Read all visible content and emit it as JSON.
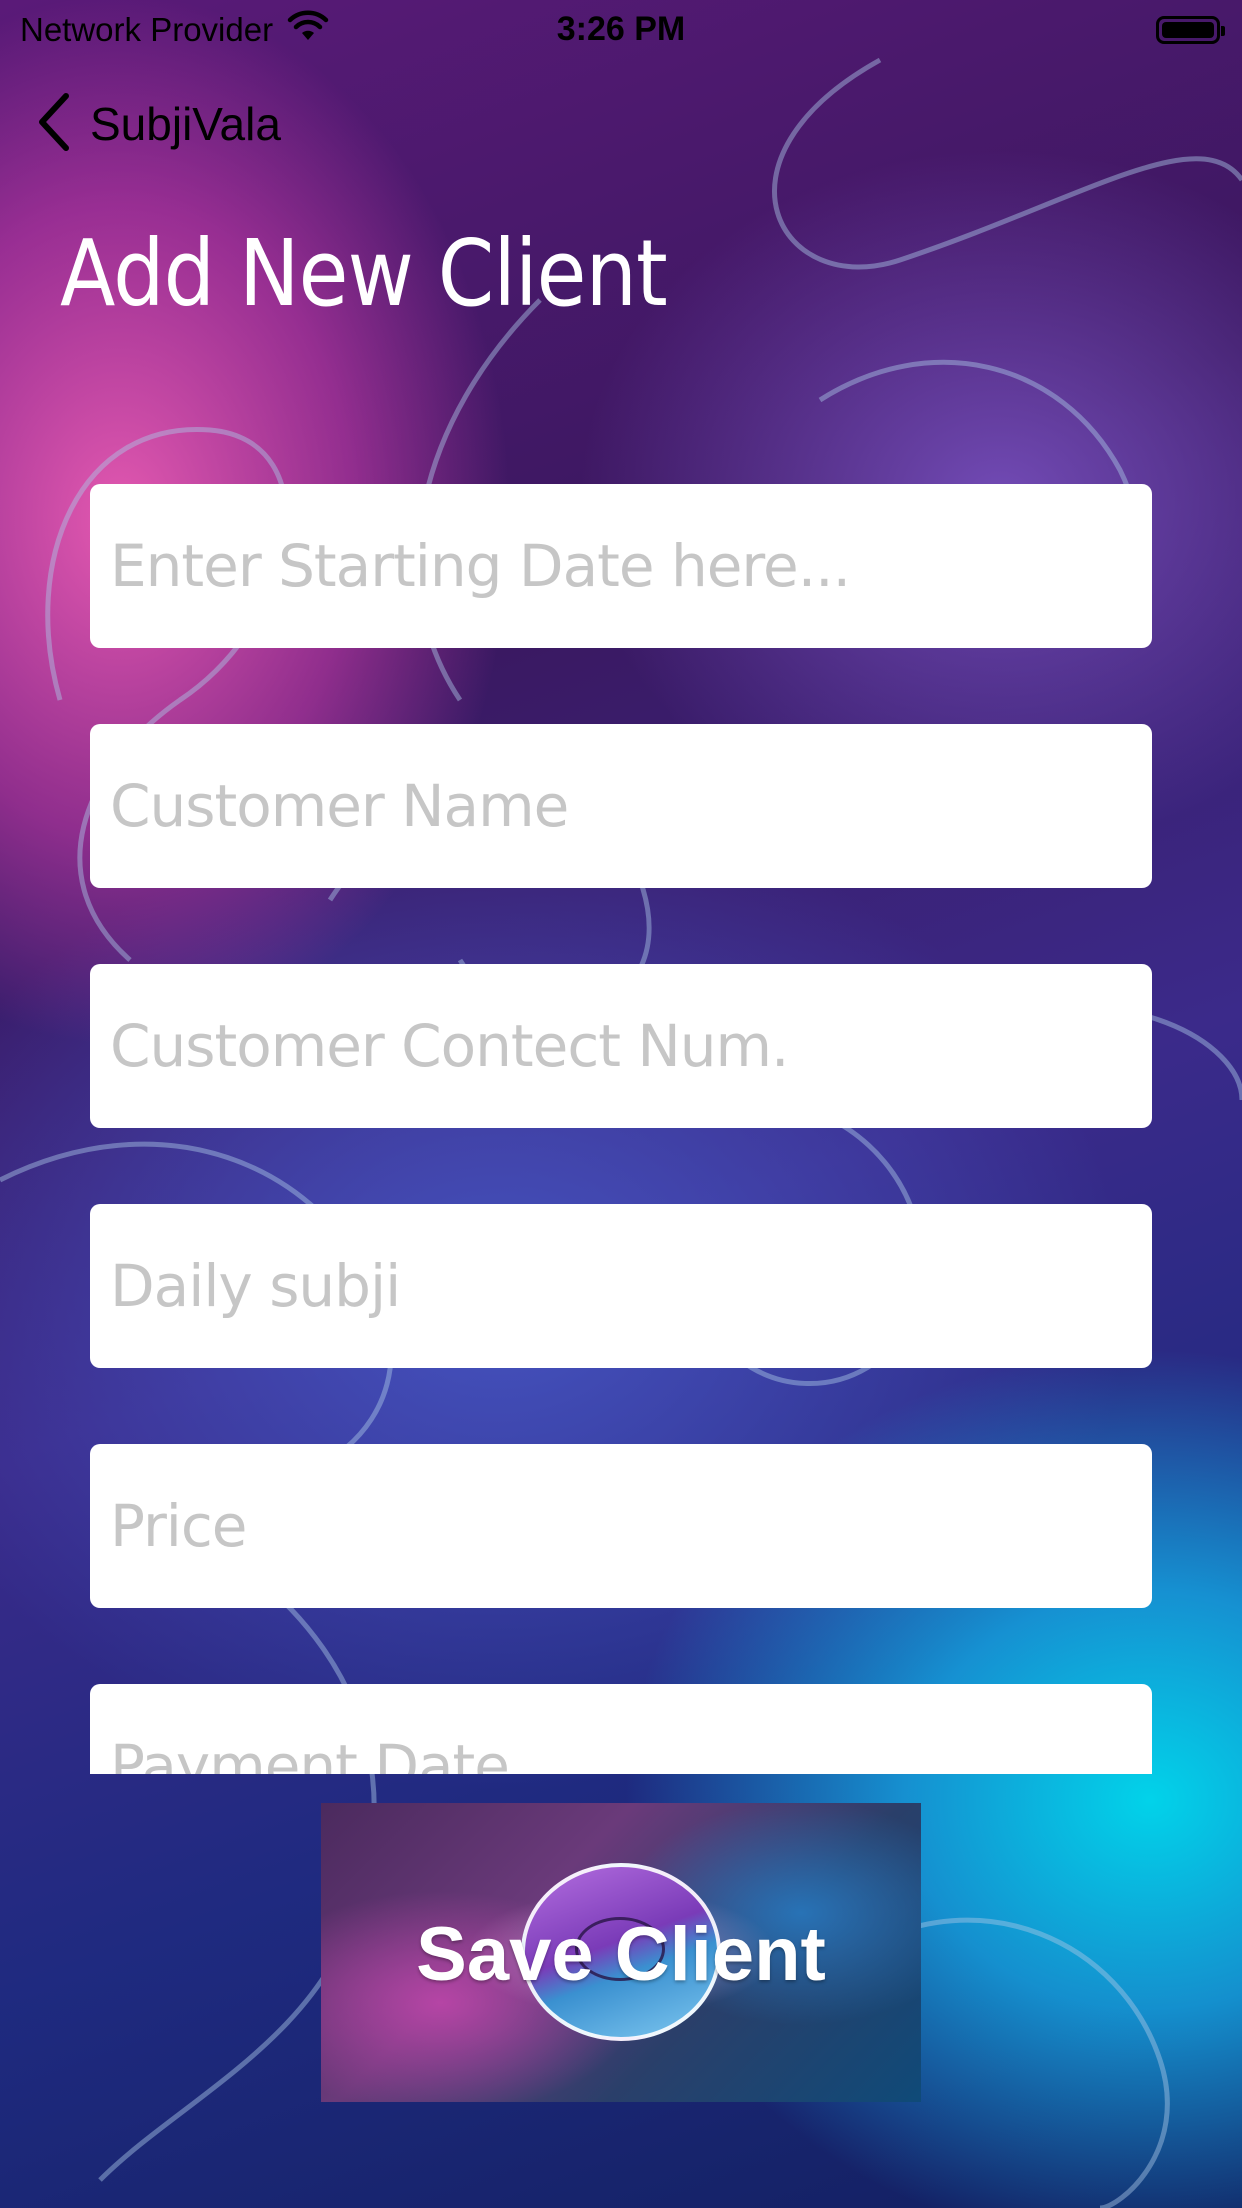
{
  "status_bar": {
    "carrier": "Network Provider",
    "time": "3:26 PM"
  },
  "nav": {
    "back_label": "SubjiVala"
  },
  "page": {
    "title": "Add New Client"
  },
  "form": {
    "fields": [
      {
        "placeholder": "Enter Starting Date here...",
        "value": ""
      },
      {
        "placeholder": "Customer Name",
        "value": ""
      },
      {
        "placeholder": "Customer Contect Num.",
        "value": ""
      },
      {
        "placeholder": "Daily subji",
        "value": ""
      },
      {
        "placeholder": "Price",
        "value": ""
      },
      {
        "placeholder": "Payment Date",
        "value": ""
      }
    ]
  },
  "save_button": {
    "label": "Save Client"
  },
  "icons": {
    "wifi": "wifi-icon",
    "battery": "battery-icon",
    "back": "chevron-left-icon"
  }
}
